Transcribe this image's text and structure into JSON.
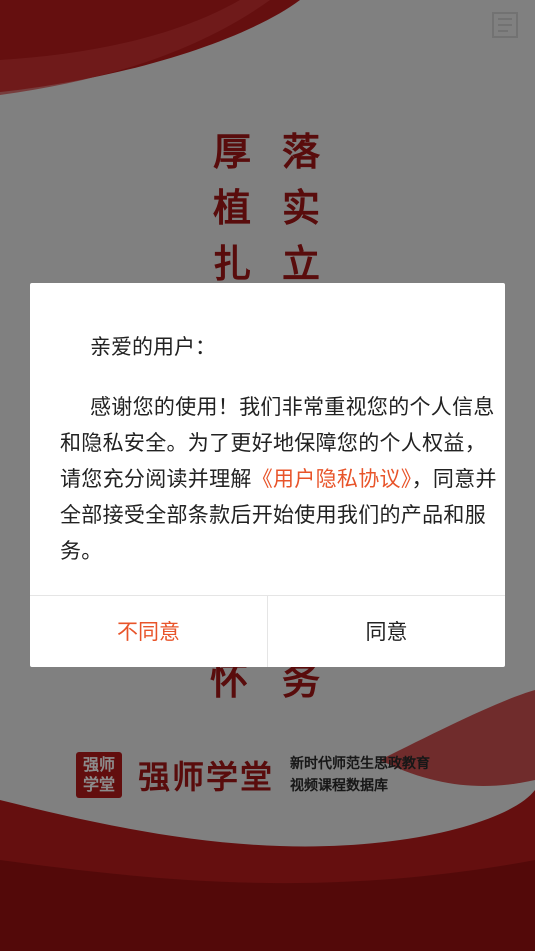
{
  "background": {
    "slogan_left": [
      "厚",
      "植",
      "扎"
    ],
    "slogan_right": [
      "落",
      "实",
      "立"
    ],
    "slogan_low_left": "怀",
    "slogan_low_right": "务",
    "brand_seal": "强师学堂",
    "brand_name": "强师学堂",
    "brand_subtitle_line1": "新时代师范生思政教育",
    "brand_subtitle_line2": "视频课程数据库"
  },
  "dialog": {
    "greeting": "亲爱的用户：",
    "body_prefix": "感谢您的使用！我们非常重视您的个人信息和隐私安全。为了更好地保障您的个人权益，请您充分阅读并理解",
    "policy_link": "《用户隐私协议》",
    "body_suffix": "，同意并全部接受全部条款后开始使用我们的产品和服务。",
    "decline_label": "不同意",
    "agree_label": "同意"
  },
  "colors": {
    "accent": "#e8542a",
    "brand_red": "#a21616"
  }
}
